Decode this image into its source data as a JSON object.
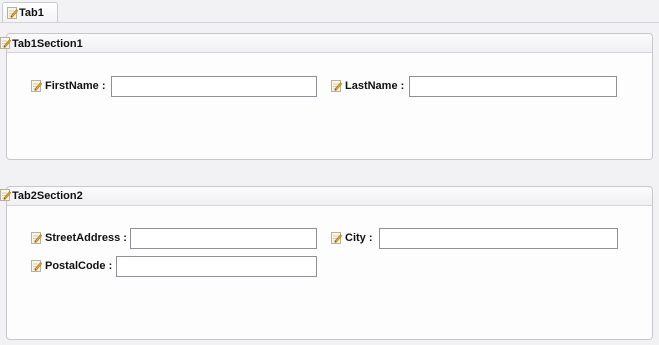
{
  "tabs": [
    {
      "label": "Tab1"
    }
  ],
  "sections": [
    {
      "title": "Tab1Section1",
      "fields": [
        {
          "label": "FirstName :",
          "value": ""
        },
        {
          "label": "LastName :",
          "value": ""
        }
      ]
    },
    {
      "title": "Tab2Section2",
      "fields": [
        {
          "label": "StreetAddress :",
          "value": ""
        },
        {
          "label": "City :",
          "value": ""
        },
        {
          "label": "PostalCode :",
          "value": ""
        }
      ]
    }
  ],
  "icons": {
    "label_icon": "edit-icon"
  }
}
